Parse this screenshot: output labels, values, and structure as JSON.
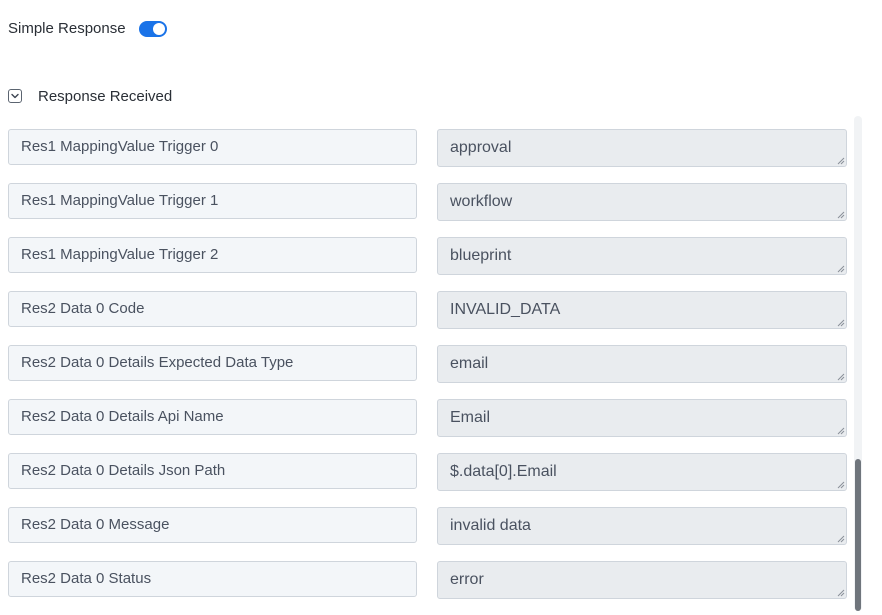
{
  "settings": {
    "simple_response_label": "Simple Response",
    "simple_response_enabled": true
  },
  "section": {
    "title": "Response Received",
    "expanded": true
  },
  "rows": [
    {
      "key": "Res1 MappingValue Trigger 0",
      "value": "approval"
    },
    {
      "key": "Res1 MappingValue Trigger 1",
      "value": "workflow"
    },
    {
      "key": "Res1 MappingValue Trigger 2",
      "value": "blueprint"
    },
    {
      "key": "Res2 Data 0 Code",
      "value": "INVALID_DATA"
    },
    {
      "key": "Res2 Data 0 Details Expected Data Type",
      "value": "email"
    },
    {
      "key": "Res2 Data 0 Details Api Name",
      "value": "Email"
    },
    {
      "key": "Res2 Data 0 Details Json Path",
      "value": "$.data[0].Email"
    },
    {
      "key": "Res2 Data 0 Message",
      "value": "invalid data"
    },
    {
      "key": "Res2 Data 0 Status",
      "value": "error"
    }
  ],
  "colors": {
    "accent": "#1a73e8",
    "key_bg": "#f3f6f9",
    "value_bg": "#e9ecef",
    "border": "#cfd5dc"
  },
  "icons": {
    "section_toggle": "chevron-down-icon",
    "textarea_resize": "resize-grip-icon"
  }
}
